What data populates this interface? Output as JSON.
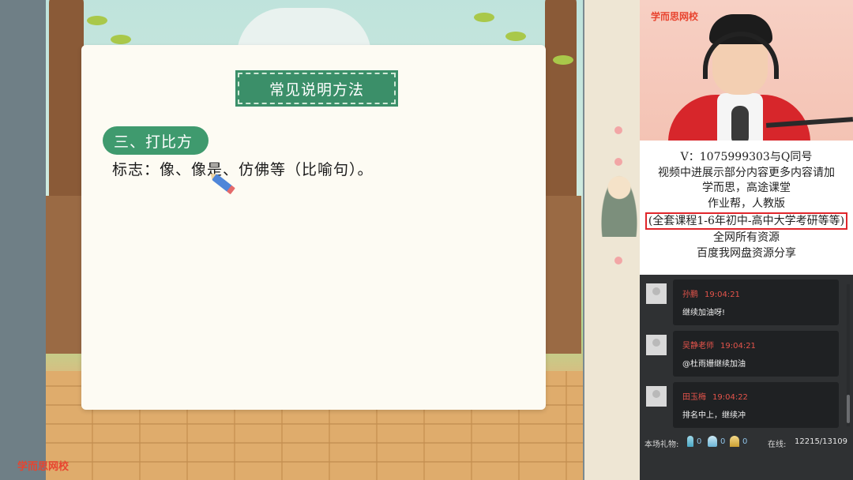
{
  "lesson": {
    "title": "常见说明方法",
    "section": "三、打比方",
    "sign_text": "标志：像、像是、仿佛等（比喻句）。",
    "logo": "学而思网校"
  },
  "video": {
    "logo": "学而思网校"
  },
  "notice": {
    "lines": [
      "V：1075999303与Q同号",
      "视频中进展示部分内容更多内容请加",
      "学而思，高途课堂",
      "作业帮，人教版",
      "(全套课程1-6年初中-高中大学考研等等)",
      "全网所有资源",
      "百度我网盘资源分享"
    ],
    "highlight_color": "#e0262b"
  },
  "chat": {
    "messages": [
      {
        "name": "孙鹏",
        "time": "19:04:21",
        "text": "继续加油呀!"
      },
      {
        "name": "吴静老师",
        "time": "19:04:21",
        "text": "@杜雨姗继续加油"
      },
      {
        "name": "田玉梅",
        "time": "19:04:22",
        "text": "排名中上，继续冲"
      }
    ]
  },
  "gifts": {
    "label": "本场礼物:",
    "counts": [
      "0",
      "0",
      "0"
    ],
    "icons": [
      "trophy-icon",
      "cup-icon",
      "crown-icon"
    ]
  },
  "online": {
    "label": "在线:",
    "value": "12215/13109"
  },
  "colors": {
    "green_banner": "#3b8f69",
    "brand_red": "#e8442f",
    "chat_name": "#e5544b"
  }
}
